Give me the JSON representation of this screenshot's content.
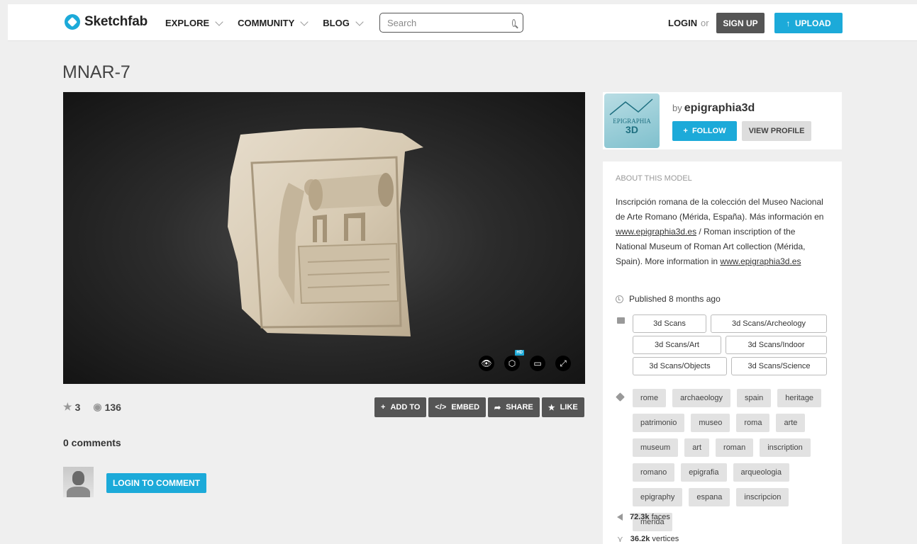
{
  "header": {
    "brand": "Sketchfab",
    "nav": [
      {
        "label": "EXPLORE"
      },
      {
        "label": "COMMUNITY"
      },
      {
        "label": "BLOG"
      }
    ],
    "search_placeholder": "Search",
    "login": "LOGIN",
    "or": "or",
    "signup": "SIGN UP",
    "upload": "UPLOAD"
  },
  "model": {
    "title": "MNAR-7",
    "likes": "3",
    "views": "136"
  },
  "actions": {
    "add_to": "ADD TO",
    "embed": "EMBED",
    "share": "SHARE",
    "like": "LIKE"
  },
  "comments": {
    "count_label": "0 comments",
    "login_button": "LOGIN TO COMMENT"
  },
  "author": {
    "by": "by",
    "name": "epigraphia3d",
    "logo_line1": "EPIGRAPHIA",
    "logo_line2": "3D",
    "follow": "FOLLOW",
    "view_profile": "VIEW PROFILE"
  },
  "about": {
    "heading": "ABOUT THIS MODEL",
    "desc_part1": "Inscripción romana de la colección del Museo Nacional de Arte Romano (Mérida, España). Más información en ",
    "link1": "www.epigraphia3d.es",
    "desc_part2": " / Roman inscription of the National Museum of Roman Art collection (Mérida, Spain). More information in ",
    "link2": "www.epigraphia3d.es",
    "published": "Published 8 months ago",
    "categories": [
      {
        "label": "3d Scans",
        "w": 104
      },
      {
        "label": "3d Scans/Archeology",
        "w": 164
      },
      {
        "label": "3d Scans/Art",
        "w": 125
      },
      {
        "label": "3d Scans/Indoor",
        "w": 143
      },
      {
        "label": "3d Scans/Objects",
        "w": 133
      },
      {
        "label": "3d Scans/Science",
        "w": 135
      }
    ],
    "tags": [
      "rome",
      "archaeology",
      "spain",
      "heritage",
      "patrimonio",
      "museo",
      "roma",
      "arte",
      "museum",
      "art",
      "roman",
      "inscription",
      "romano",
      "epigrafia",
      "arqueologia",
      "epigraphy",
      "espana",
      "inscripcion",
      "merida"
    ],
    "faces_count": "72.3k",
    "faces_label": "faces",
    "vertices_count": "36.2k",
    "vertices_label": "vertices"
  },
  "colors": {
    "accent": "#1caad9",
    "dark_button": "#555555",
    "background": "#efefef"
  }
}
